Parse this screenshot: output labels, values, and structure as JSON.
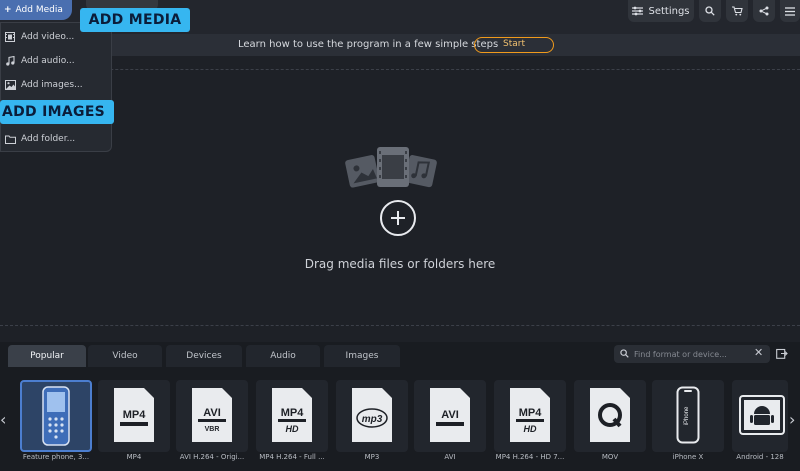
{
  "toolbar": {
    "add_media_label": "Add Media",
    "settings_label": "Settings",
    "icons": [
      "plus-icon",
      "sliders-icon",
      "search-icon",
      "cart-icon",
      "share-icon",
      "hamburger-icon"
    ]
  },
  "callouts": {
    "add_media": "ADD MEDIA",
    "add_images": "ADD IMAGES"
  },
  "dropdown": {
    "items": [
      {
        "label": "Add video...",
        "icon": "film-icon"
      },
      {
        "label": "Add audio...",
        "icon": "music-note-icon"
      },
      {
        "label": "Add images...",
        "icon": "image-icon"
      },
      {
        "label": "Add folder...",
        "icon": "folder-icon"
      }
    ]
  },
  "learn_bar": {
    "text": "Learn how to use the program in a few simple steps",
    "start_label": "Start"
  },
  "drop_area": {
    "text": "Drag media files or folders here"
  },
  "formats": {
    "tabs": [
      {
        "label": "Popular",
        "active": true
      },
      {
        "label": "Video",
        "active": false
      },
      {
        "label": "Devices",
        "active": false
      },
      {
        "label": "Audio",
        "active": false
      },
      {
        "label": "Images",
        "active": false
      }
    ],
    "search_placeholder": "Find format or device...",
    "tiles": [
      {
        "label": "Feature phone, 3...",
        "badge": "",
        "sub": "",
        "icon": "feature-phone-icon",
        "selected": true
      },
      {
        "label": "MP4",
        "badge": "MP4",
        "sub": "",
        "icon": "mp4-icon",
        "selected": false
      },
      {
        "label": "AVI H.264 - Origi...",
        "badge": "AVI",
        "sub": "VBR",
        "icon": "avi-icon",
        "selected": false
      },
      {
        "label": "MP4 H.264 - Full ...",
        "badge": "MP4",
        "sub": "HD",
        "icon": "mp4-hd-icon",
        "selected": false
      },
      {
        "label": "MP3",
        "badge": "mp3",
        "sub": "",
        "icon": "mp3-icon",
        "selected": false
      },
      {
        "label": "AVI",
        "badge": "AVI",
        "sub": "",
        "icon": "avi-icon",
        "selected": false
      },
      {
        "label": "MP4 H.264 - HD 7...",
        "badge": "MP4",
        "sub": "HD",
        "icon": "mp4-hd-icon",
        "selected": false
      },
      {
        "label": "MOV",
        "badge": "",
        "sub": "",
        "icon": "quicktime-icon",
        "selected": false
      },
      {
        "label": "iPhone X",
        "badge": "iPhone",
        "sub": "",
        "icon": "iphone-icon",
        "selected": false
      },
      {
        "label": "Android - 128",
        "badge": "",
        "sub": "",
        "icon": "android-icon",
        "selected": false
      }
    ]
  },
  "colors": {
    "accent_blue": "#4a6fb0",
    "callout_cyan": "#36b6f0",
    "start_orange": "#f09a1c",
    "background": "#1e2127"
  }
}
